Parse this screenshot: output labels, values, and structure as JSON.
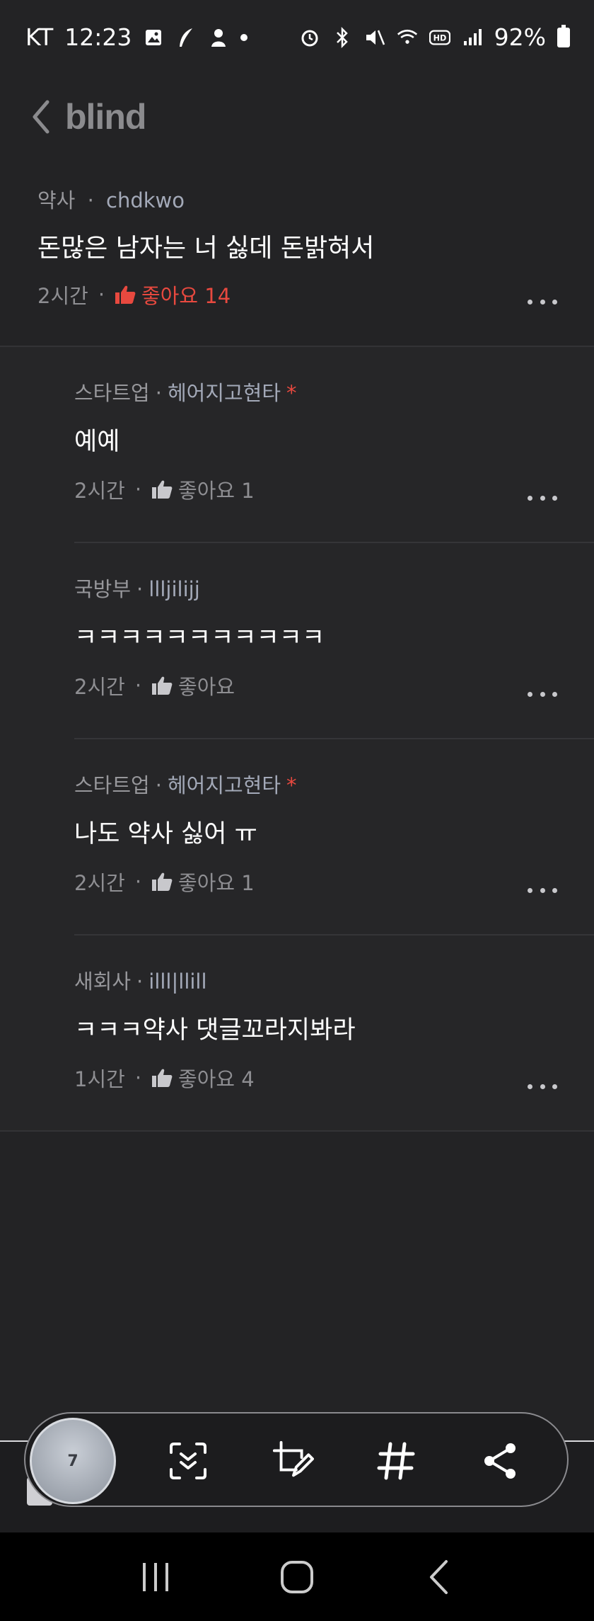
{
  "status_bar": {
    "carrier": "KT",
    "time": "12:23",
    "battery": "92%"
  },
  "header": {
    "logo": "blind"
  },
  "post": {
    "company": "약사",
    "nickname": "chdkwo",
    "body": "돈많은 남자는 너 싫데  돈밝혀서",
    "time": "2시간",
    "like_label": "좋아요 14",
    "like_color": "#e8493f"
  },
  "comments": [
    {
      "company": "스타트업",
      "nickname": "헤어지고현타",
      "author_mark": "*",
      "body": "예예",
      "time": "2시간",
      "like_label": "좋아요 1"
    },
    {
      "company": "국방부",
      "nickname": "llljilijj",
      "author_mark": "",
      "body": "ㅋㅋㅋㅋㅋㅋㅋㅋㅋㅋㅋ",
      "time": "2시간",
      "like_label": "좋아요"
    },
    {
      "company": "스타트업",
      "nickname": "헤어지고현타",
      "author_mark": "*",
      "body": "나도 약사 싫어 ㅠ",
      "time": "2시간",
      "like_label": "좋아요 1"
    },
    {
      "company": "새회사",
      "nickname": "illl|llill",
      "author_mark": "",
      "body": "ㅋㅋㅋ약사 댓글꼬라지봐라",
      "time": "1시간",
      "like_label": "좋아요 4"
    }
  ],
  "toolbar": {
    "avatar_number": "7",
    "icons": [
      "scroll-capture-icon",
      "crop-edit-icon",
      "hashtag-icon",
      "share-icon"
    ]
  },
  "separator": "·",
  "nav_icons": [
    "recent-apps-icon",
    "home-icon",
    "back-icon"
  ]
}
